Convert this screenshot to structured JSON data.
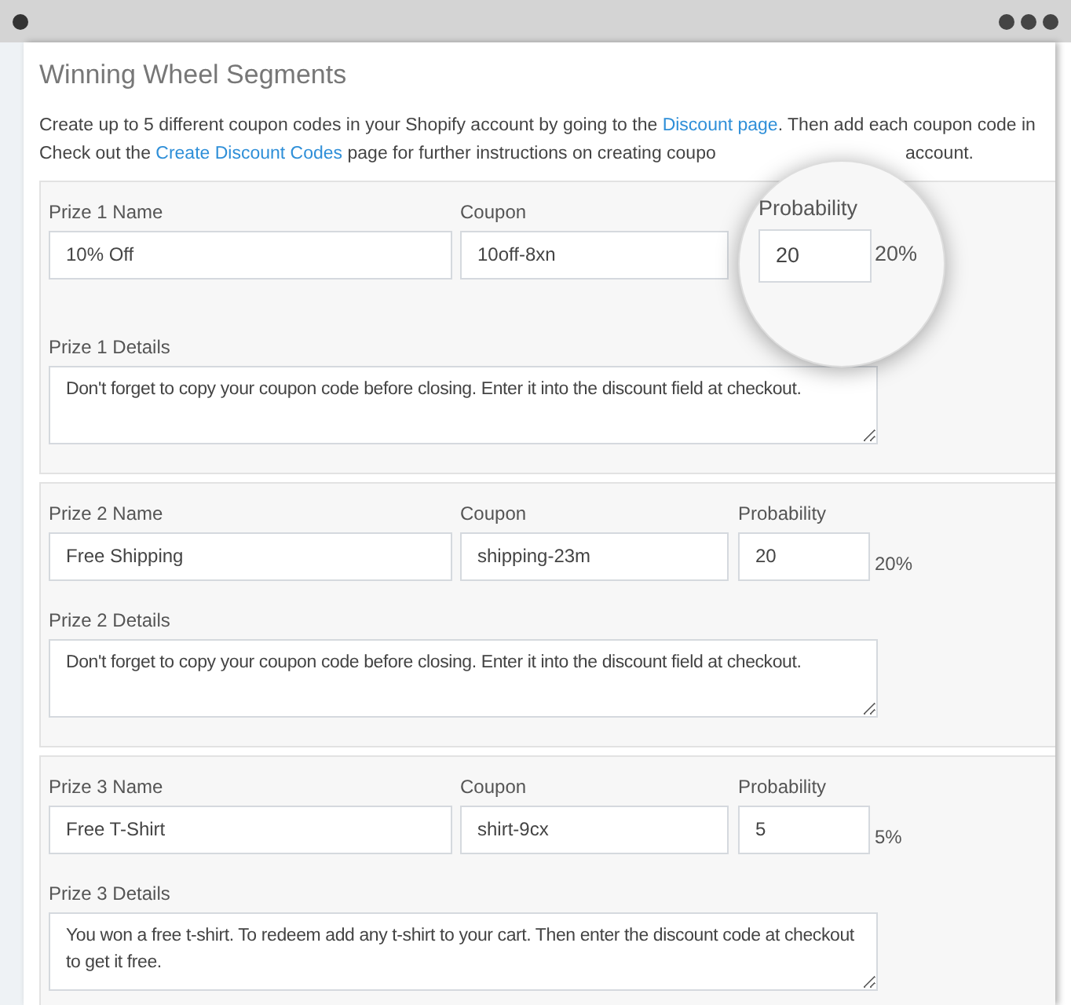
{
  "title": "Winning Wheel Segments",
  "intro": {
    "line_1": [
      "Create up to 5 different coupon codes in your Shopify account by going to the ",
      {
        "link": "Discount page"
      },
      ". Then add each coupon code in"
    ],
    "line_2": [
      "Check out the ",
      {
        "link": "Create Discount Codes"
      },
      " page for further instructions on creating coupo"
    ],
    "line_2_end": "account."
  },
  "prizes": [
    {
      "name_label": "Prize 1 Name",
      "name": "10% Off",
      "coupon_label": "Coupon",
      "coupon": "10off-8xn",
      "probability_label": "Probability",
      "probability": "20",
      "percent": "20%",
      "details_label": "Prize 1 Details",
      "details": "Don't forget to copy your coupon code before closing. Enter it into the discount field at checkout.",
      "magnified": true
    },
    {
      "name_label": "Prize 2 Name",
      "name": "Free Shipping",
      "coupon_label": "Coupon",
      "coupon": "shipping-23m",
      "probability_label": "Probability",
      "probability": "20",
      "percent": "20%",
      "details_label": "Prize 2 Details",
      "details": "Don't forget to copy your coupon code before closing. Enter it into the discount field at checkout.",
      "magnified": false
    },
    {
      "name_label": "Prize 3 Name",
      "name": "Free T-Shirt",
      "coupon_label": "Coupon",
      "coupon": "shirt-9cx",
      "probability_label": "Probability",
      "probability": "5",
      "percent": "5%",
      "details_label": "Prize 3 Details",
      "details": "You won a free t-shirt. To redeem add any t-shirt to your cart. Then enter the discount code at checkout to get it free.",
      "magnified": false
    }
  ]
}
